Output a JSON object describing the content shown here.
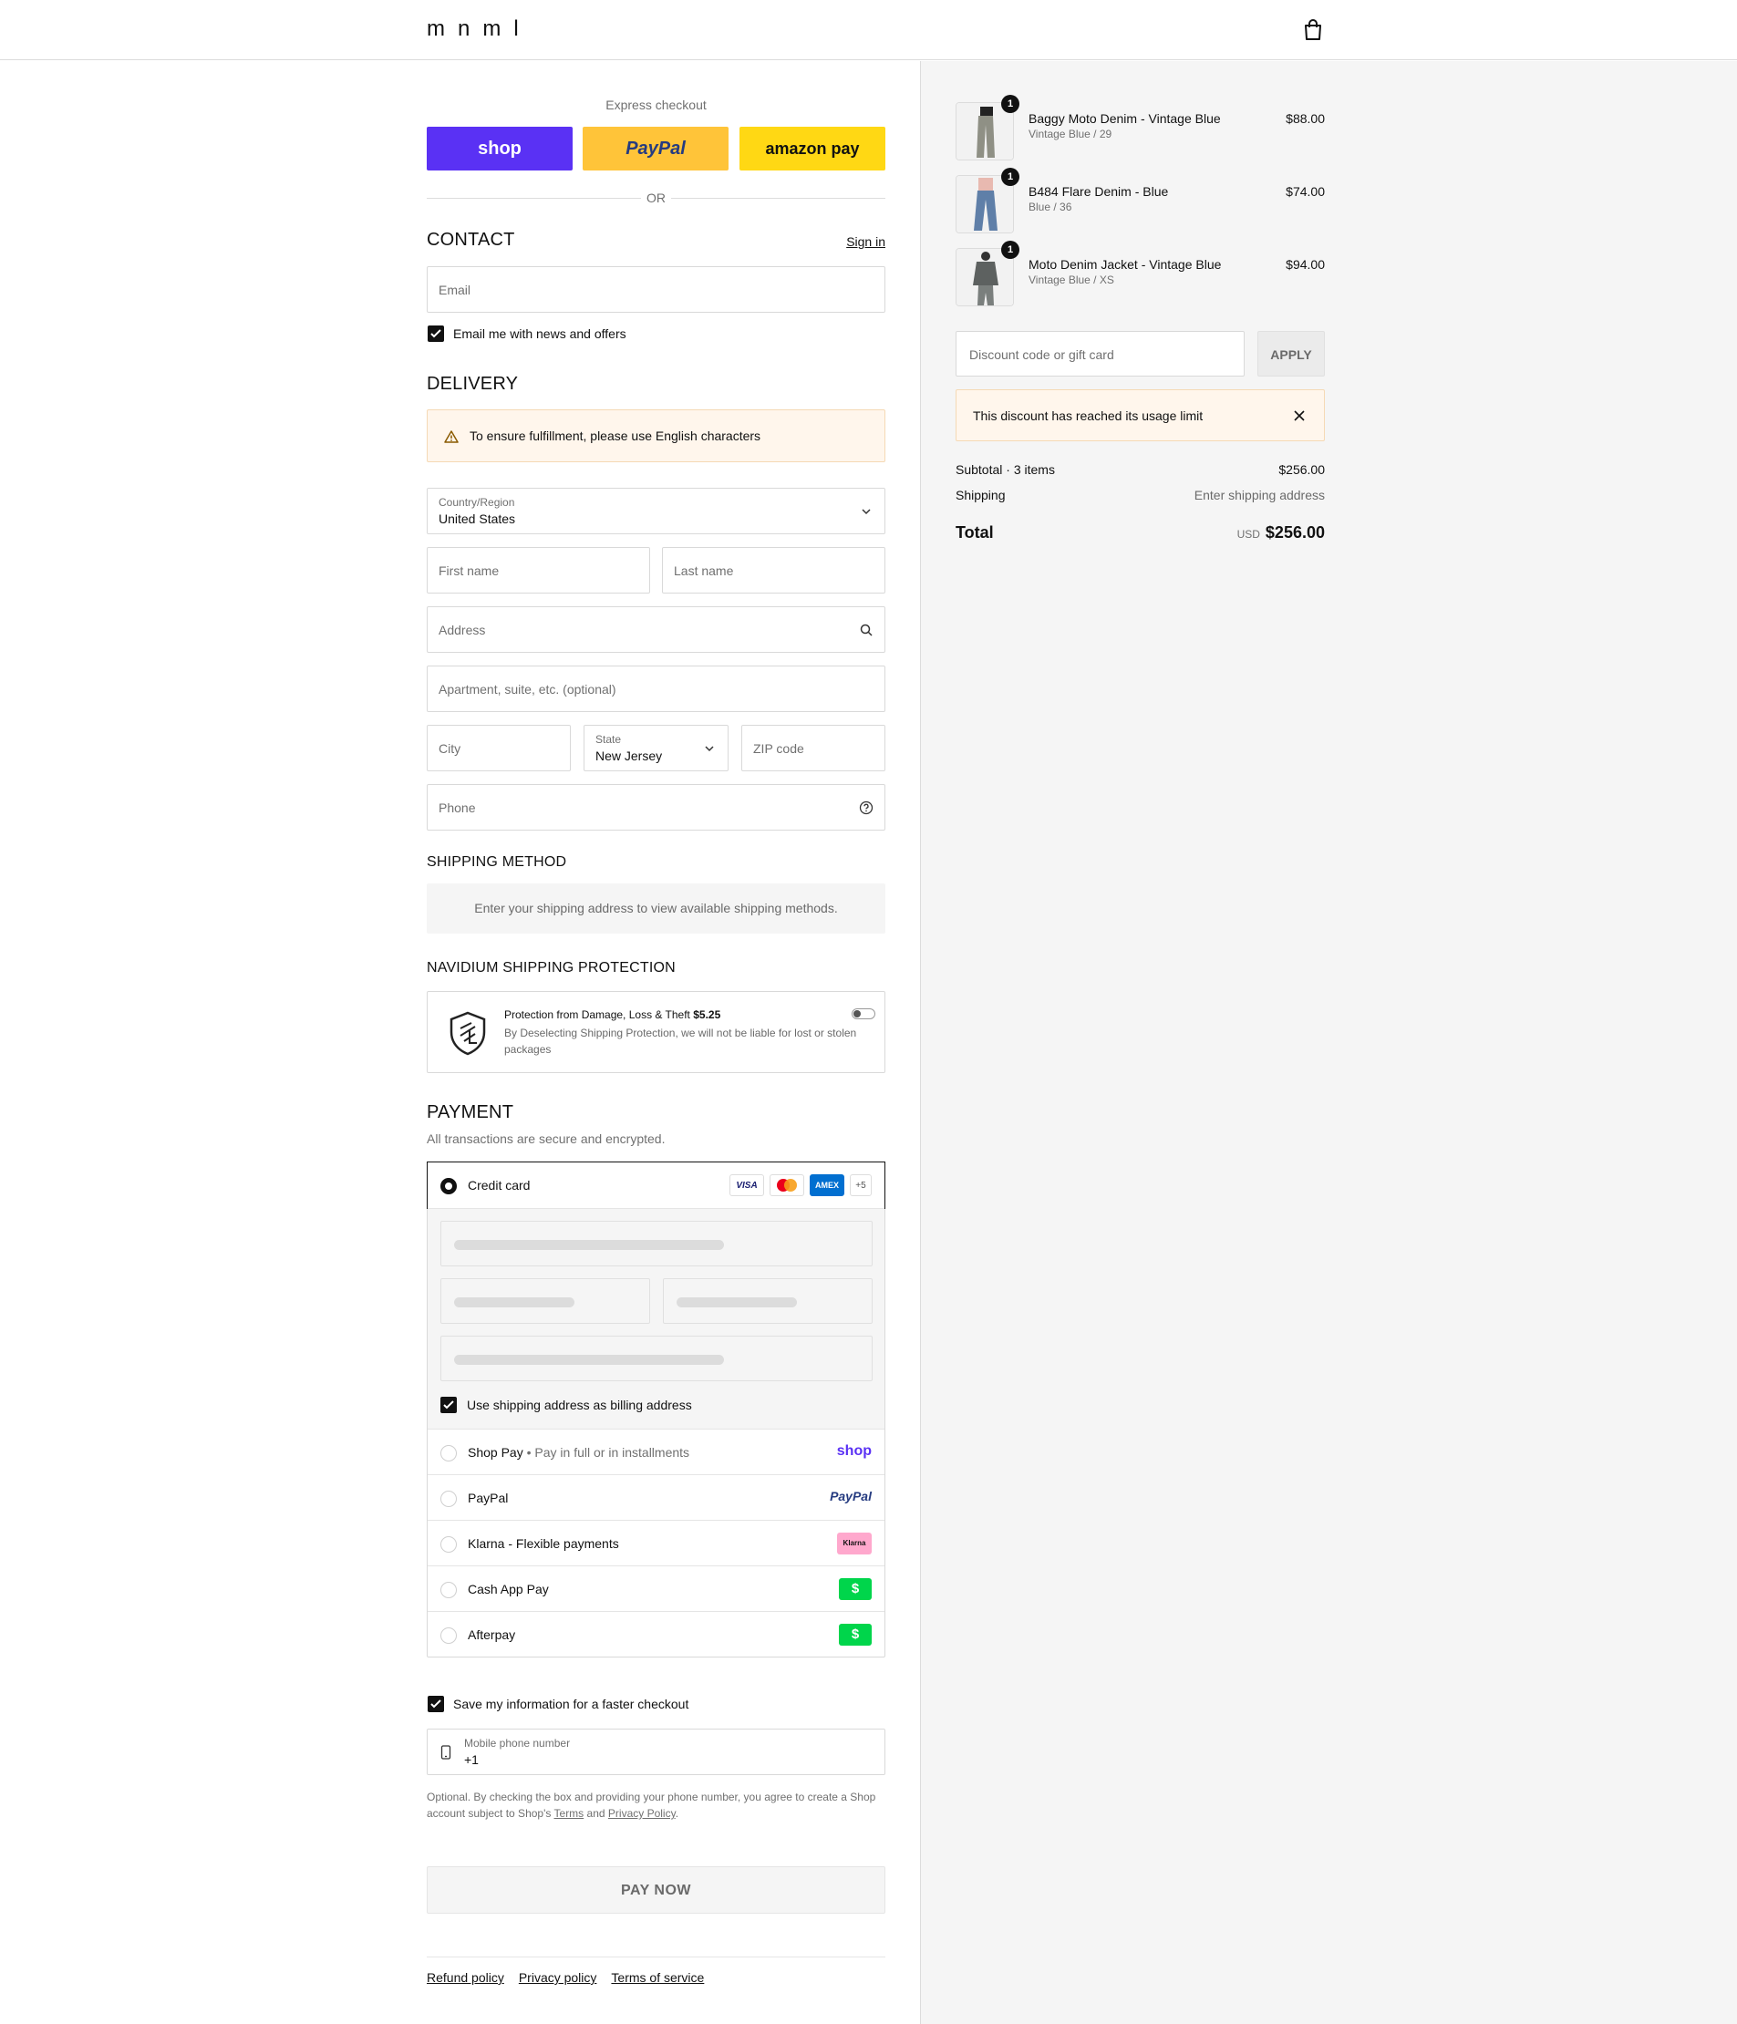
{
  "brand": {
    "logo": "mnml"
  },
  "express": {
    "label": "Express checkout",
    "shop_label": "shop",
    "paypal_label": "PayPal",
    "amazon_label": "amazon pay",
    "or_label": "OR"
  },
  "contact": {
    "title": "CONTACT",
    "signin": "Sign in",
    "email_placeholder": "Email",
    "news_label": "Email me with news and offers"
  },
  "delivery": {
    "title": "DELIVERY",
    "notice": "To ensure fulfillment, please use English characters",
    "country_label": "Country/Region",
    "country_value": "United States",
    "first_name": "First name",
    "last_name": "Last name",
    "address": "Address",
    "apartment": "Apartment, suite, etc. (optional)",
    "city": "City",
    "state_label": "State",
    "state_value": "New Jersey",
    "zip": "ZIP code",
    "phone": "Phone"
  },
  "shipping_method": {
    "title": "SHIPPING METHOD",
    "info": "Enter your shipping address to view available shipping methods."
  },
  "protection": {
    "title": "NAVIDIUM SHIPPING PROTECTION",
    "heading": "Protection from Damage, Loss & Theft",
    "price": "$5.25",
    "desc": "By Deselecting Shipping Protection, we will not be liable for lost or stolen packages"
  },
  "payment": {
    "title": "PAYMENT",
    "subtitle": "All transactions are secure and encrypted.",
    "credit_card": "Credit card",
    "card_logos": [
      "VISA",
      "MC",
      "AMEX"
    ],
    "more_cards": "+5",
    "billing_label": "Use shipping address as billing address",
    "shop_pay": "Shop Pay",
    "shop_pay_sep": "•",
    "shop_pay_sub": "Pay in full or in installments",
    "shop_pay_logo": "shop",
    "paypal": "PayPal",
    "paypal_logo": "PayPal",
    "klarna": "Klarna - Flexible payments",
    "klarna_logo": "Klarna",
    "cashapp": "Cash App Pay",
    "afterpay": "Afterpay",
    "dollar_logo": "$"
  },
  "remember": {
    "label": "Save my information for a faster checkout",
    "mobile_label": "Mobile phone number",
    "mobile_value": "+1",
    "legal_pre": "Optional. By checking the box and providing your phone number, you agree to create a Shop account subject to Shop's",
    "terms": "Terms",
    "and": "and",
    "privacy": "Privacy Policy",
    "period": "."
  },
  "pay_now": "PAY NOW",
  "footer": {
    "refund": "Refund policy",
    "privacy": "Privacy policy",
    "terms": "Terms of service"
  },
  "cart": {
    "items": [
      {
        "name": "Baggy Moto Denim - Vintage Blue",
        "variant": "Vintage Blue / 29",
        "price": "$88.00",
        "qty": "1"
      },
      {
        "name": "B484 Flare Denim - Blue",
        "variant": "Blue / 36",
        "price": "$74.00",
        "qty": "1"
      },
      {
        "name": "Moto Denim Jacket - Vintage Blue",
        "variant": "Vintage Blue / XS",
        "price": "$94.00",
        "qty": "1"
      }
    ],
    "discount_placeholder": "Discount code or gift card",
    "apply": "APPLY",
    "discount_notice": "This discount has reached its usage limit",
    "subtotal_label": "Subtotal · 3 items",
    "subtotal_value": "$256.00",
    "shipping_label": "Shipping",
    "shipping_value": "Enter shipping address",
    "total_label": "Total",
    "currency": "USD",
    "total_value": "$256.00"
  }
}
